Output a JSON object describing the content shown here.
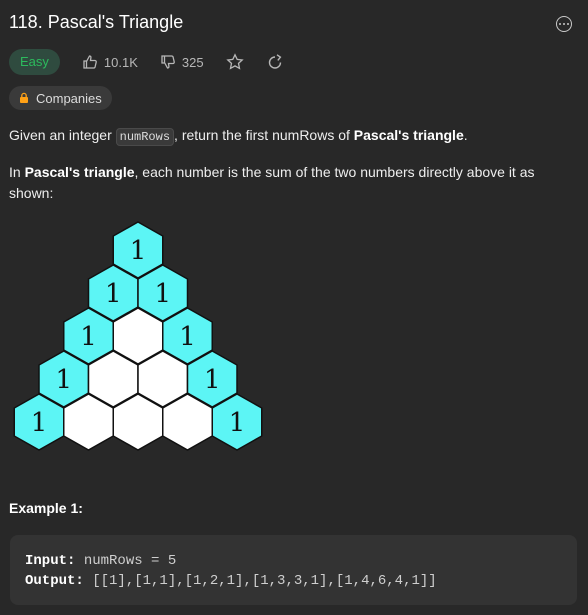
{
  "problem": {
    "title": "118. Pascal's Triangle",
    "difficulty": "Easy",
    "likes": "10.1K",
    "dislikes": "325",
    "companies_label": "Companies"
  },
  "description": {
    "p1_prefix": "Given an integer ",
    "p1_code": "numRows",
    "p1_mid": ", return the first numRows of ",
    "p1_bold": "Pascal's triangle",
    "p1_end": ".",
    "p2_prefix": "In ",
    "p2_bold": "Pascal's triangle",
    "p2_rest": ", each number is the sum of the two numbers directly above it as shown:"
  },
  "triangle": {
    "fill_color": "#5cf5f5",
    "rows": [
      [
        "1"
      ],
      [
        "1",
        "1"
      ],
      [
        "1",
        "",
        "1"
      ],
      [
        "1",
        "",
        "",
        "1"
      ],
      [
        "1",
        "",
        "",
        "",
        "1"
      ]
    ]
  },
  "example": {
    "title": "Example 1:",
    "input_label": "Input:",
    "input_value": "numRows = 5",
    "output_label": "Output:",
    "output_value": "[[1],[1,1],[1,2,1],[1,3,3,1],[1,4,6,4,1]]"
  },
  "colors": {
    "easy": "#2cbb5d",
    "background": "#282828"
  }
}
